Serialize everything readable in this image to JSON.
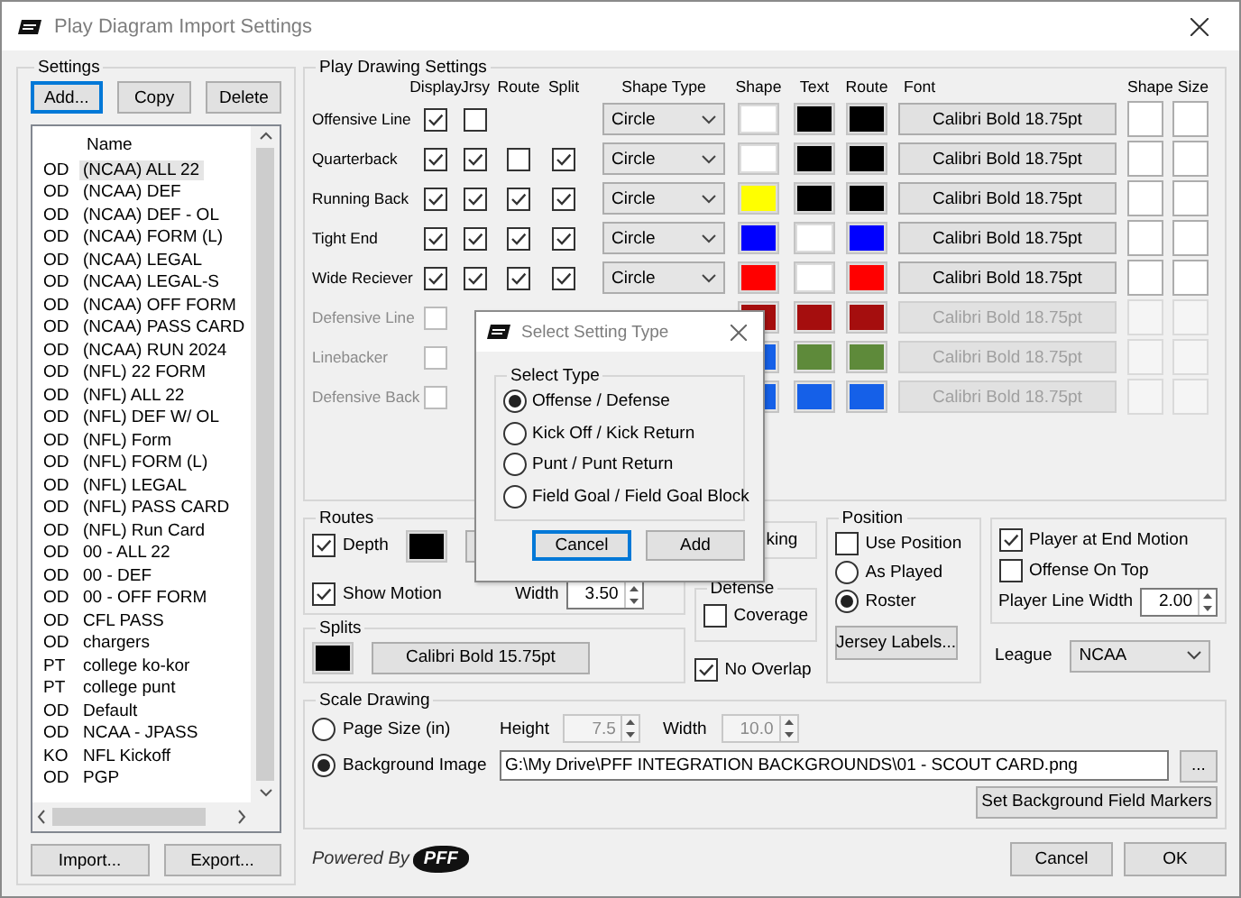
{
  "window": {
    "title": "Play Diagram Import Settings"
  },
  "settings": {
    "title": "Settings",
    "buttons": [
      {
        "label": "Add...",
        "focused": true
      },
      {
        "label": "Copy",
        "focused": false
      },
      {
        "label": "Delete",
        "focused": false
      }
    ],
    "list": {
      "header": "Name",
      "rows": [
        {
          "type": "OD",
          "name": "(NCAA) ALL 22",
          "selected": true
        },
        {
          "type": "OD",
          "name": "(NCAA) DEF",
          "selected": false
        },
        {
          "type": "OD",
          "name": "(NCAA) DEF - OL",
          "selected": false
        },
        {
          "type": "OD",
          "name": "(NCAA) FORM (L)",
          "selected": false
        },
        {
          "type": "OD",
          "name": "(NCAA) LEGAL",
          "selected": false
        },
        {
          "type": "OD",
          "name": "(NCAA) LEGAL-S",
          "selected": false
        },
        {
          "type": "OD",
          "name": "(NCAA) OFF FORM",
          "selected": false
        },
        {
          "type": "OD",
          "name": "(NCAA) PASS CARD",
          "selected": false
        },
        {
          "type": "OD",
          "name": "(NCAA) RUN 2024",
          "selected": false
        },
        {
          "type": "OD",
          "name": "(NFL) 22 FORM",
          "selected": false
        },
        {
          "type": "OD",
          "name": "(NFL) ALL 22",
          "selected": false
        },
        {
          "type": "OD",
          "name": "(NFL) DEF W/ OL",
          "selected": false
        },
        {
          "type": "OD",
          "name": "(NFL) Form",
          "selected": false
        },
        {
          "type": "OD",
          "name": "(NFL) FORM (L)",
          "selected": false
        },
        {
          "type": "OD",
          "name": "(NFL) LEGAL",
          "selected": false
        },
        {
          "type": "OD",
          "name": "(NFL) PASS CARD",
          "selected": false
        },
        {
          "type": "OD",
          "name": "(NFL) Run Card",
          "selected": false
        },
        {
          "type": "OD",
          "name": "00 - ALL 22",
          "selected": false
        },
        {
          "type": "OD",
          "name": "00 - DEF",
          "selected": false
        },
        {
          "type": "OD",
          "name": "00 - OFF FORM",
          "selected": false
        },
        {
          "type": "OD",
          "name": "CFL PASS",
          "selected": false
        },
        {
          "type": "OD",
          "name": "chargers",
          "selected": false
        },
        {
          "type": "PT",
          "name": "college ko-kor",
          "selected": false
        },
        {
          "type": "PT",
          "name": "college punt",
          "selected": false
        },
        {
          "type": "OD",
          "name": "Default",
          "selected": false
        },
        {
          "type": "OD",
          "name": "NCAA - JPASS",
          "selected": false
        },
        {
          "type": "KO",
          "name": "NFL Kickoff",
          "selected": false
        },
        {
          "type": "OD",
          "name": "PGP",
          "selected": false
        }
      ]
    },
    "bottom_buttons": [
      "Import...",
      "Export..."
    ]
  },
  "play_drawing": {
    "title": "Play Drawing Settings",
    "columns": [
      "Display",
      "Jrsy",
      "Route",
      "Split",
      "Shape Type",
      "Shape",
      "Text",
      "Route",
      "Font",
      "Shape Size"
    ],
    "rows": [
      {
        "label": "Offensive Line",
        "enabled": true,
        "display": true,
        "jrsy": false,
        "shape_type": "Circle",
        "swatches": [
          {
            "color": "#ffffff"
          },
          {
            "color": "#000000"
          },
          {
            "color": "#000000"
          }
        ],
        "font": "Calibri Bold 18.75pt"
      },
      {
        "label": "Quarterback",
        "enabled": true,
        "display": true,
        "jrsy": true,
        "route": false,
        "split": true,
        "shape_type": "Circle",
        "swatches": [
          {
            "color": "#ffffff"
          },
          {
            "color": "#000000"
          },
          {
            "color": "#000000"
          }
        ],
        "font": "Calibri Bold 18.75pt"
      },
      {
        "label": "Running Back",
        "enabled": true,
        "display": true,
        "jrsy": true,
        "route": true,
        "split": true,
        "shape_type": "Circle",
        "swatches": [
          {
            "color": "#ffff00"
          },
          {
            "color": "#000000"
          },
          {
            "color": "#000000"
          }
        ],
        "font": "Calibri Bold 18.75pt"
      },
      {
        "label": "Tight End",
        "enabled": true,
        "display": true,
        "jrsy": true,
        "route": true,
        "split": true,
        "shape_type": "Circle",
        "swatches": [
          {
            "color": "#0000ff"
          },
          {
            "color": "#ffffff"
          },
          {
            "color": "#0000ff"
          }
        ],
        "font": "Calibri Bold 18.75pt"
      },
      {
        "label": "Wide Reciever",
        "enabled": true,
        "display": true,
        "jrsy": true,
        "route": true,
        "split": true,
        "shape_type": "Circle",
        "swatches": [
          {
            "color": "#ff0000"
          },
          {
            "color": "#ffffff"
          },
          {
            "color": "#ff0000"
          }
        ],
        "font": "Calibri Bold 18.75pt"
      },
      {
        "label": "Defensive Line",
        "enabled": false,
        "display": false,
        "swatches": [
          {
            "color": "#a50e0e"
          },
          {
            "color": "#a50e0e"
          },
          {
            "color": "#a50e0e"
          }
        ],
        "font": "Calibri Bold 18.75pt"
      },
      {
        "label": "Linebacker",
        "enabled": false,
        "display": false,
        "swatches": [
          {
            "color": "#1560e8"
          },
          {
            "color": "#5e8a3a"
          },
          {
            "color": "#5e8a3a"
          }
        ],
        "font": "Calibri Bold 18.75pt"
      },
      {
        "label": "Defensive Back",
        "enabled": false,
        "display": false,
        "swatches": [
          {
            "color": "#1560e8"
          },
          {
            "color": "#1560e8"
          },
          {
            "color": "#1560e8"
          }
        ],
        "font": "Calibri Bold 18.75pt"
      }
    ]
  },
  "routes": {
    "title": "Routes",
    "depth": {
      "label": "Depth",
      "checked": true,
      "color": "#000000"
    },
    "show_motion": {
      "label": "Show Motion",
      "checked": true
    },
    "width": {
      "label": "Width",
      "value": "3.50"
    }
  },
  "splits": {
    "title": "Splits",
    "color": "#000000",
    "font": "Calibri Bold 15.75pt"
  },
  "blocking": {
    "label": "king"
  },
  "defense": {
    "title": "Defense",
    "coverage": {
      "label": "Coverage",
      "checked": false
    }
  },
  "no_overlap": {
    "label": "No Overlap",
    "checked": true
  },
  "position": {
    "title": "Position",
    "use_position": {
      "label": "Use Position",
      "checked": false
    },
    "options": [
      {
        "label": "As Played",
        "selected": false
      },
      {
        "label": "Roster",
        "selected": true
      }
    ],
    "button": "Jersey Labels..."
  },
  "motion": {
    "end_motion": {
      "label": "Player at End Motion",
      "checked": true
    },
    "offense_on_top": {
      "label": "Offense On Top",
      "checked": false
    },
    "line_width": {
      "label": "Player Line Width",
      "value": "2.00"
    }
  },
  "league": {
    "label": "League",
    "value": "NCAA"
  },
  "scale": {
    "title": "Scale Drawing",
    "options": [
      {
        "label": "Page Size (in)",
        "selected": false
      },
      {
        "label": "Background Image",
        "selected": true
      }
    ],
    "height": {
      "label": "Height",
      "value": "7.5",
      "disabled": true
    },
    "width": {
      "label": "Width",
      "value": "10.0",
      "disabled": true
    },
    "path": "G:\\My Drive\\PFF INTEGRATION BACKGROUNDS\\01 - SCOUT CARD.png",
    "browse": "...",
    "markers_button": "Set Background Field Markers"
  },
  "footer": {
    "powered_by": "Powered By",
    "logo": "PFF",
    "buttons": [
      "Cancel",
      "OK"
    ]
  },
  "modal": {
    "title": "Select Setting Type",
    "group": "Select Type",
    "options": [
      {
        "label": "Offense / Defense",
        "selected": true
      },
      {
        "label": "Kick Off / Kick Return",
        "selected": false
      },
      {
        "label": "Punt / Punt Return",
        "selected": false
      },
      {
        "label": "Field Goal / Field Goal Block",
        "selected": false
      }
    ],
    "buttons": [
      {
        "label": "Cancel",
        "focused": true
      },
      {
        "label": "Add",
        "focused": false
      }
    ]
  }
}
